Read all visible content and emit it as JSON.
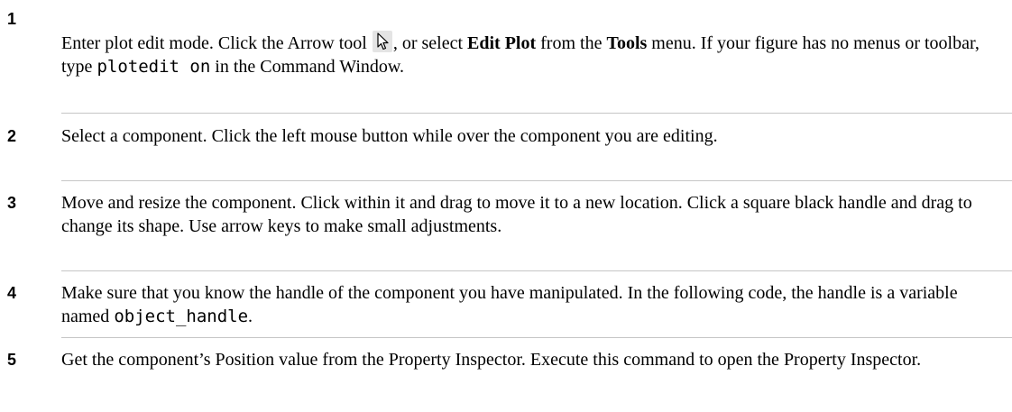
{
  "steps": [
    {
      "number": "1",
      "intro": "Enter plot edit mode. Click the Arrow tool ",
      "t2": ", or select ",
      "b1": "Edit Plot",
      "t3": " from the ",
      "b2": "Tools",
      "t4": " menu. If your figure has no menus or toolbar, type ",
      "code": "plotedit on",
      "t5": " in the Command Window.",
      "icon": "arrow-tool-icon"
    },
    {
      "number": "2",
      "text": "Select a component. Click the left mouse button while over the component you are editing."
    },
    {
      "number": "3",
      "text": "Move and resize the component. Click within it and drag to move it to a new location. Click a square black handle and drag to change its shape. Use arrow keys to make small adjustments."
    },
    {
      "number": "4",
      "text": "Make sure that you know the handle of the component you have manipulated. In the following code, the handle is a variable named ",
      "code": "object_handle",
      "tail": "."
    },
    {
      "number": "5",
      "text": "Get the component’s Position value from the Property Inspector. Execute this command to open the Property Inspector."
    }
  ]
}
